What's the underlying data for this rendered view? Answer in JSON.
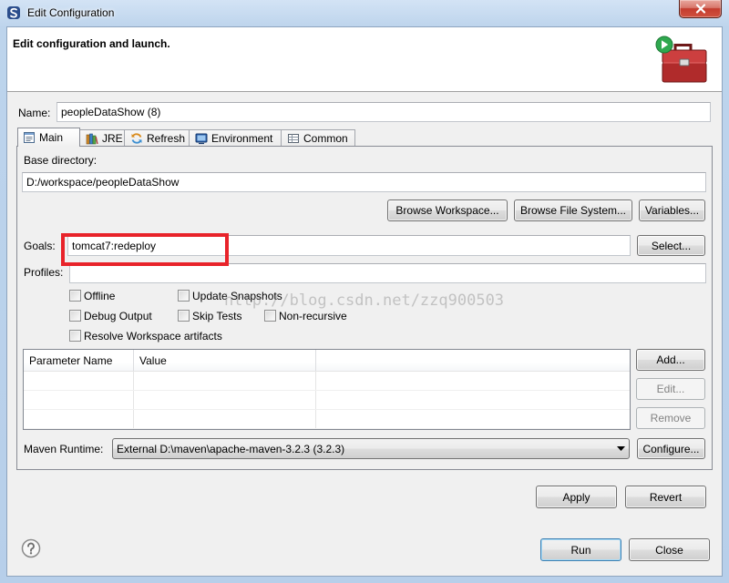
{
  "window": {
    "title": "Edit Configuration",
    "app_icon": "app-icon",
    "close_icon": "close-icon"
  },
  "header": {
    "title": "Edit configuration and launch.",
    "icon": "launch-toolbox-icon"
  },
  "name": {
    "label": "Name:",
    "value": "peopleDataShow (8)"
  },
  "tabs": [
    {
      "label": "Main",
      "icon": "main-tab-icon",
      "selected": true
    },
    {
      "label": "JRE",
      "icon": "jre-icon",
      "selected": false
    },
    {
      "label": "Refresh",
      "icon": "refresh-icon",
      "selected": false
    },
    {
      "label": "Environment",
      "icon": "environment-icon",
      "selected": false
    },
    {
      "label": "Common",
      "icon": "common-icon",
      "selected": false
    }
  ],
  "main": {
    "base_directory": {
      "label": "Base directory:",
      "value": "D:/workspace/peopleDataShow"
    },
    "buttons": {
      "browse_workspace": "Browse Workspace...",
      "browse_file_system": "Browse File System...",
      "variables": "Variables..."
    },
    "goals": {
      "label": "Goals:",
      "value": "tomcat7:redeploy",
      "select_button": "Select..."
    },
    "profiles": {
      "label": "Profiles:",
      "value": ""
    },
    "options": [
      {
        "label": "Offline",
        "checked": false
      },
      {
        "label": "Update Snapshots",
        "checked": false
      },
      {
        "label": "Debug Output",
        "checked": false
      },
      {
        "label": "Skip Tests",
        "checked": false
      },
      {
        "label": "Non-recursive",
        "checked": false
      },
      {
        "label": "Resolve Workspace artifacts",
        "checked": false
      }
    ],
    "parameters": {
      "columns": [
        "Parameter Name",
        "Value"
      ],
      "rows": [],
      "add_button": "Add...",
      "edit_button": "Edit...",
      "remove_button": "Remove",
      "edit_enabled": false,
      "remove_enabled": false
    },
    "maven_runtime": {
      "label": "Maven Runtime:",
      "selected": "External D:\\maven\\apache-maven-3.2.3 (3.2.3)",
      "configure_button": "Configure..."
    },
    "apply_button": "Apply",
    "revert_button": "Revert"
  },
  "footer": {
    "help_icon": "help-icon",
    "run_button": "Run",
    "close_button": "Close"
  },
  "watermark": "http://blog.csdn.net/zzq900503",
  "colors": {
    "highlight_box": "#e8232a",
    "focus_border": "#3c7fb1",
    "frame": "#b9d1ea",
    "panel_background": "#f0f0f0"
  }
}
